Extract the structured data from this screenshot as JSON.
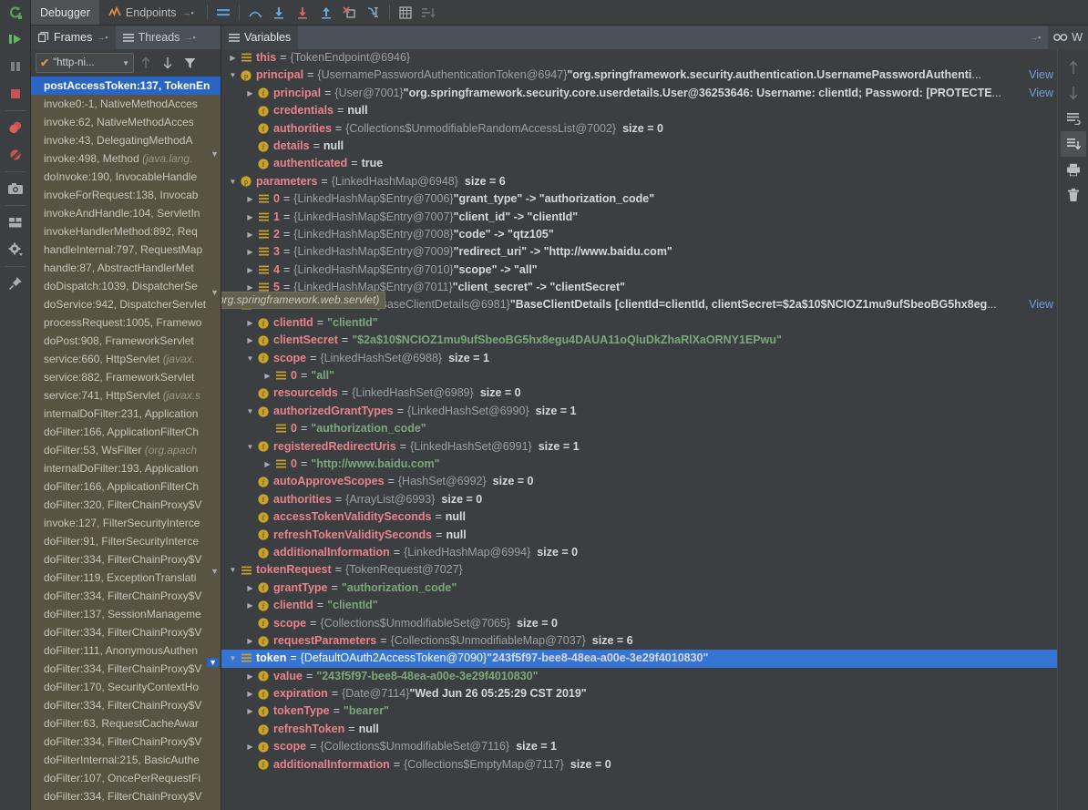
{
  "window": {
    "title": "Debugger"
  },
  "toolbar": {
    "tabs": [
      {
        "label": "Debugger",
        "icon": "debugger-icon",
        "active": true,
        "pin": "→▪"
      },
      {
        "label": "Endpoints",
        "icon": "endpoints-icon",
        "active": false,
        "pin": "→▪"
      }
    ],
    "buttons": [
      {
        "name": "show-execution-point-icon",
        "title": "Show Execution Point"
      },
      {
        "name": "step-over-icon",
        "title": "Step Over"
      },
      {
        "name": "step-into-icon",
        "title": "Step Into"
      },
      {
        "name": "force-step-into-icon",
        "title": "Force Step Into"
      },
      {
        "name": "step-out-icon",
        "title": "Step Out"
      },
      {
        "name": "drop-frame-icon",
        "title": "Drop Frame"
      },
      {
        "name": "run-to-cursor-icon",
        "title": "Run to Cursor"
      },
      {
        "name": "evaluate-expression-icon",
        "title": "Evaluate Expression"
      },
      {
        "name": "sort-values-icon",
        "title": "Sort Values"
      }
    ]
  },
  "rail": {
    "items": [
      {
        "name": "rerun-icon",
        "label": "Rerun"
      },
      {
        "name": "resume-program-icon",
        "label": "Resume Program"
      },
      {
        "name": "pause-program-icon",
        "label": "Pause Program"
      },
      {
        "name": "stop-icon",
        "label": "Stop"
      },
      {
        "name": "view-breakpoints-icon",
        "label": "View Breakpoints"
      },
      {
        "name": "mute-breakpoints-icon",
        "label": "Mute Breakpoints"
      },
      {
        "name": "screenshot-icon",
        "label": "Get thread dump"
      },
      {
        "name": "layout-icon",
        "label": "Restore Layout"
      },
      {
        "name": "settings-icon",
        "label": "Settings"
      },
      {
        "name": "pin-icon",
        "label": "Pin Tab"
      }
    ]
  },
  "frames": {
    "tabs": [
      {
        "label": "Frames",
        "icon": "frames-icon",
        "active": true,
        "pin": "→▪"
      },
      {
        "label": "Threads",
        "icon": "threads-icon",
        "active": false,
        "pin": "→▪"
      }
    ],
    "thread_selector": {
      "value": "\"http-ni...",
      "caret": "▼",
      "check": "✔"
    },
    "toolbar_icons": [
      {
        "name": "frame-up-icon",
        "glyph": "↑"
      },
      {
        "name": "frame-down-icon",
        "glyph": "↓"
      },
      {
        "name": "filter-frames-icon",
        "glyph": "filter"
      }
    ],
    "items": [
      {
        "method": "postAccessToken:137, TokenEn",
        "pkg": "",
        "selected": true
      },
      {
        "method": "invoke0:-1, NativeMethodAcces",
        "pkg": ""
      },
      {
        "method": "invoke:62, NativeMethodAcces",
        "pkg": ""
      },
      {
        "method": "invoke:43, DelegatingMethodA",
        "pkg": ""
      },
      {
        "method": "invoke:498, Method ",
        "pkg": "(java.lang."
      },
      {
        "method": "doInvoke:190, InvocableHandle",
        "pkg": ""
      },
      {
        "method": "invokeForRequest:138, Invocab",
        "pkg": ""
      },
      {
        "method": "invokeAndHandle:104, ServletIn",
        "pkg": ""
      },
      {
        "method": "invokeHandlerMethod:892, Req",
        "pkg": ""
      },
      {
        "method": "handleInternal:797, RequestMap",
        "pkg": ""
      },
      {
        "method": "handle:87, AbstractHandlerMet",
        "pkg": ""
      },
      {
        "method": "doDispatch:1039, DispatcherSe",
        "pkg": ""
      },
      {
        "method": "doService:942, DispatcherServlet",
        "pkg": ""
      },
      {
        "method": "processRequest:1005, Framewo",
        "pkg": ""
      },
      {
        "method": "doPost:908, FrameworkServlet",
        "pkg": ""
      },
      {
        "method": "service:660, HttpServlet ",
        "pkg": "(javax."
      },
      {
        "method": "service:882, FrameworkServlet",
        "pkg": ""
      },
      {
        "method": "service:741, HttpServlet ",
        "pkg": "(javax.s"
      },
      {
        "method": "internalDoFilter:231, Application",
        "pkg": ""
      },
      {
        "method": "doFilter:166, ApplicationFilterCh",
        "pkg": ""
      },
      {
        "method": "doFilter:53, WsFilter ",
        "pkg": "(org.apach"
      },
      {
        "method": "internalDoFilter:193, Application",
        "pkg": ""
      },
      {
        "method": "doFilter:166, ApplicationFilterCh",
        "pkg": ""
      },
      {
        "method": "doFilter:320, FilterChainProxy$V",
        "pkg": ""
      },
      {
        "method": "invoke:127, FilterSecurityIntercе",
        "pkg": ""
      },
      {
        "method": "doFilter:91, FilterSecurityIntercе",
        "pkg": ""
      },
      {
        "method": "doFilter:334, FilterChainProxy$V",
        "pkg": ""
      },
      {
        "method": "doFilter:119, ExceptionTranslati",
        "pkg": ""
      },
      {
        "method": "doFilter:334, FilterChainProxy$V",
        "pkg": ""
      },
      {
        "method": "doFilter:137, SessionManageme",
        "pkg": ""
      },
      {
        "method": "doFilter:334, FilterChainProxy$V",
        "pkg": ""
      },
      {
        "method": "doFilter:111, AnonymousAuthen",
        "pkg": ""
      },
      {
        "method": "doFilter:334, FilterChainProxy$V",
        "pkg": ""
      },
      {
        "method": "doFilter:170, SecurityContextHo",
        "pkg": ""
      },
      {
        "method": "doFilter:334, FilterChainProxy$V",
        "pkg": ""
      },
      {
        "method": "doFilter:63, RequestCacheAwar",
        "pkg": ""
      },
      {
        "method": "doFilter:334, FilterChainProxy$V",
        "pkg": ""
      },
      {
        "method": "doFilterInternal:215, BasicAuthe",
        "pkg": ""
      },
      {
        "method": "doFilter:107, OncePerRequestFi",
        "pkg": ""
      },
      {
        "method": "doFilter:334, FilterChainProxy$V",
        "pkg": ""
      }
    ]
  },
  "variables": {
    "tab": {
      "label": "Variables",
      "icon": "variables-icon"
    },
    "watches_tab": {
      "label": "W",
      "icon": "watches-icon",
      "pin": "→▪"
    },
    "right_icons": [
      {
        "name": "move-up-icon",
        "glyph": "↑",
        "active": false
      },
      {
        "name": "move-down-icon",
        "glyph": "↓",
        "active": false
      },
      {
        "name": "new-watch-icon",
        "glyph": "new-watch",
        "active": false
      },
      {
        "name": "add-to-watches-icon",
        "glyph": "add-watch",
        "active": true
      },
      {
        "name": "print-icon",
        "glyph": "print",
        "active": false
      },
      {
        "name": "remove-watch-icon",
        "glyph": "trash",
        "active": false
      }
    ],
    "tooltip": {
      "text": "(org.springframework.web.servlet)"
    },
    "rows": [
      {
        "indent": 0,
        "arrow": "right",
        "badge": "list",
        "name": "this",
        "eq": "=",
        "type": "{TokenEndpoint@6946}"
      },
      {
        "indent": 0,
        "arrow": "down",
        "badge": "param",
        "name": "principal",
        "eq": "=",
        "type": "{UsernamePasswordAuthenticationToken@6947}",
        "string": "\"org.springframework.security.authentication.UsernamePasswordAuthenti",
        "ellipsis": "...",
        "view": "View"
      },
      {
        "indent": 1,
        "arrow": "right",
        "badge": "field",
        "name": "principal",
        "eq": "=",
        "type": "{User@7001}",
        "string": "\"org.springframework.security.core.userdetails.User@36253646: Username: clientId; Password: [PROTECTE",
        "ellipsis": "...",
        "view": "View"
      },
      {
        "indent": 1,
        "arrow": "none",
        "badge": "field",
        "name": "credentials",
        "eq": "=",
        "literal": "null"
      },
      {
        "indent": 1,
        "arrow": "none",
        "badge": "field",
        "name": "authorities",
        "eq": "=",
        "type": "{Collections$UnmodifiableRandomAccessList@7002}",
        "size": "size = 0"
      },
      {
        "indent": 1,
        "arrow": "none",
        "badge": "field",
        "name": "details",
        "eq": "=",
        "literal": "null"
      },
      {
        "indent": 1,
        "arrow": "none",
        "badge": "field",
        "name": "authenticated",
        "eq": "=",
        "literal": "true"
      },
      {
        "indent": 0,
        "arrow": "down",
        "badge": "param",
        "name": "parameters",
        "eq": "=",
        "type": "{LinkedHashMap@6948}",
        "size": "size = 6"
      },
      {
        "indent": 1,
        "arrow": "right",
        "badge": "list",
        "name": "0",
        "eq": "=",
        "type": "{LinkedHashMap$Entry@7006}",
        "kv": "\"grant_type\" -> \"authorization_code\""
      },
      {
        "indent": 1,
        "arrow": "right",
        "badge": "list",
        "name": "1",
        "eq": "=",
        "type": "{LinkedHashMap$Entry@7007}",
        "kv": "\"client_id\" -> \"clientId\""
      },
      {
        "indent": 1,
        "arrow": "right",
        "badge": "list",
        "name": "2",
        "eq": "=",
        "type": "{LinkedHashMap$Entry@7008}",
        "kv": "\"code\" -> \"qtz105\""
      },
      {
        "indent": 1,
        "arrow": "right",
        "badge": "list",
        "name": "3",
        "eq": "=",
        "type": "{LinkedHashMap$Entry@7009}",
        "kv": "\"redirect_uri\" -> \"http://www.baidu.com\""
      },
      {
        "indent": 1,
        "arrow": "right",
        "badge": "list",
        "name": "4",
        "eq": "=",
        "type": "{LinkedHashMap$Entry@7010}",
        "kv": "\"scope\" -> \"all\""
      },
      {
        "indent": 1,
        "arrow": "right",
        "badge": "list",
        "name": "5",
        "eq": "=",
        "type": "{LinkedHashMap$Entry@7011}",
        "kv": "\"client_secret\" -> \"clientSecret\""
      },
      {
        "indent": 0,
        "arrow": "down",
        "badge": "list",
        "name": "authenticatedClient",
        "eq": "=",
        "type": "{BaseClientDetails@6981}",
        "string": "\"BaseClientDetails [clientId=clientId, clientSecret=$2a$10$NCIOZ1mu9ufSbeoBG5hx8eg",
        "ellipsis": "...",
        "view": "View"
      },
      {
        "indent": 1,
        "arrow": "right",
        "badge": "field",
        "name": "clientId",
        "eq": "=",
        "string": "\"clientId\""
      },
      {
        "indent": 1,
        "arrow": "right",
        "badge": "field",
        "name": "clientSecret",
        "eq": "=",
        "string": "\"$2a$10$NCIOZ1mu9ufSbeoBG5hx8egu4DAUA11oQluDkZhaRlXaORNY1EPwu\""
      },
      {
        "indent": 1,
        "arrow": "down",
        "badge": "field",
        "name": "scope",
        "eq": "=",
        "type": "{LinkedHashSet@6988}",
        "size": "size = 1"
      },
      {
        "indent": 2,
        "arrow": "right",
        "badge": "list",
        "name": "0",
        "eq": "=",
        "string": "\"all\""
      },
      {
        "indent": 1,
        "arrow": "none",
        "badge": "field",
        "name": "resourceIds",
        "eq": "=",
        "type": "{LinkedHashSet@6989}",
        "size": "size = 0"
      },
      {
        "indent": 1,
        "arrow": "down",
        "badge": "field",
        "name": "authorizedGrantTypes",
        "eq": "=",
        "type": "{LinkedHashSet@6990}",
        "size": "size = 1"
      },
      {
        "indent": 2,
        "arrow": "none",
        "badge": "list",
        "name": "0",
        "eq": "=",
        "string": "\"authorization_code\""
      },
      {
        "indent": 1,
        "arrow": "down",
        "badge": "field",
        "name": "registeredRedirectUris",
        "eq": "=",
        "type": "{LinkedHashSet@6991}",
        "size": "size = 1"
      },
      {
        "indent": 2,
        "arrow": "right",
        "badge": "list",
        "name": "0",
        "eq": "=",
        "string": "\"http://www.baidu.com\""
      },
      {
        "indent": 1,
        "arrow": "none",
        "badge": "field",
        "name": "autoApproveScopes",
        "eq": "=",
        "type": "{HashSet@6992}",
        "size": "size = 0"
      },
      {
        "indent": 1,
        "arrow": "none",
        "badge": "field",
        "name": "authorities",
        "eq": "=",
        "type": "{ArrayList@6993}",
        "size": "size = 0"
      },
      {
        "indent": 1,
        "arrow": "none",
        "badge": "field",
        "name": "accessTokenValiditySeconds",
        "eq": "=",
        "literal": "null"
      },
      {
        "indent": 1,
        "arrow": "none",
        "badge": "field",
        "name": "refreshTokenValiditySeconds",
        "eq": "=",
        "literal": "null"
      },
      {
        "indent": 1,
        "arrow": "none",
        "badge": "field",
        "name": "additionalInformation",
        "eq": "=",
        "type": "{LinkedHashMap@6994}",
        "size": "size = 0"
      },
      {
        "indent": 0,
        "arrow": "down",
        "badge": "list",
        "name": "tokenRequest",
        "eq": "=",
        "type": "{TokenRequest@7027}"
      },
      {
        "indent": 1,
        "arrow": "right",
        "badge": "field",
        "name": "grantType",
        "eq": "=",
        "string": "\"authorization_code\""
      },
      {
        "indent": 1,
        "arrow": "right",
        "badge": "field",
        "name": "clientId",
        "eq": "=",
        "string": "\"clientId\""
      },
      {
        "indent": 1,
        "arrow": "none",
        "badge": "field",
        "name": "scope",
        "eq": "=",
        "type": "{Collections$UnmodifiableSet@7065}",
        "size": "size = 0"
      },
      {
        "indent": 1,
        "arrow": "right",
        "badge": "field",
        "name": "requestParameters",
        "eq": "=",
        "type": "{Collections$UnmodifiableMap@7037}",
        "size": "size = 6"
      },
      {
        "indent": 0,
        "arrow": "down",
        "badge": "list",
        "name": "token",
        "eq": "=",
        "type": "{DefaultOAuth2AccessToken@7090}",
        "string": "\"243f5f97-bee8-48ea-a00e-3e29f4010830\"",
        "selected": true
      },
      {
        "indent": 1,
        "arrow": "right",
        "badge": "field",
        "name": "value",
        "eq": "=",
        "string": "\"243f5f97-bee8-48ea-a00e-3e29f4010830\""
      },
      {
        "indent": 1,
        "arrow": "right",
        "badge": "field",
        "name": "expiration",
        "eq": "=",
        "type": "{Date@7114}",
        "string2": "\"Wed Jun 26 05:25:29 CST 2019\""
      },
      {
        "indent": 1,
        "arrow": "right",
        "badge": "field",
        "name": "tokenType",
        "eq": "=",
        "string": "\"bearer\""
      },
      {
        "indent": 1,
        "arrow": "none",
        "badge": "field",
        "name": "refreshToken",
        "eq": "=",
        "literal": "null"
      },
      {
        "indent": 1,
        "arrow": "right",
        "badge": "field",
        "name": "scope",
        "eq": "=",
        "type": "{Collections$UnmodifiableSet@7116}",
        "size": "size = 1"
      },
      {
        "indent": 1,
        "arrow": "none",
        "badge": "field",
        "name": "additionalInformation",
        "eq": "=",
        "type": "{Collections$EmptyMap@7117}",
        "size": "size = 0"
      }
    ]
  },
  "colors": {
    "bg": "#3c3f41",
    "frames_bg": "#585343",
    "selection": "#2b65c4",
    "var_selection": "#3675d4",
    "name": "#e8838b",
    "string": "#7aa87a",
    "type": "#9ba0a4",
    "link": "#6fa0dd",
    "tooltip_bg": "#63604f"
  }
}
